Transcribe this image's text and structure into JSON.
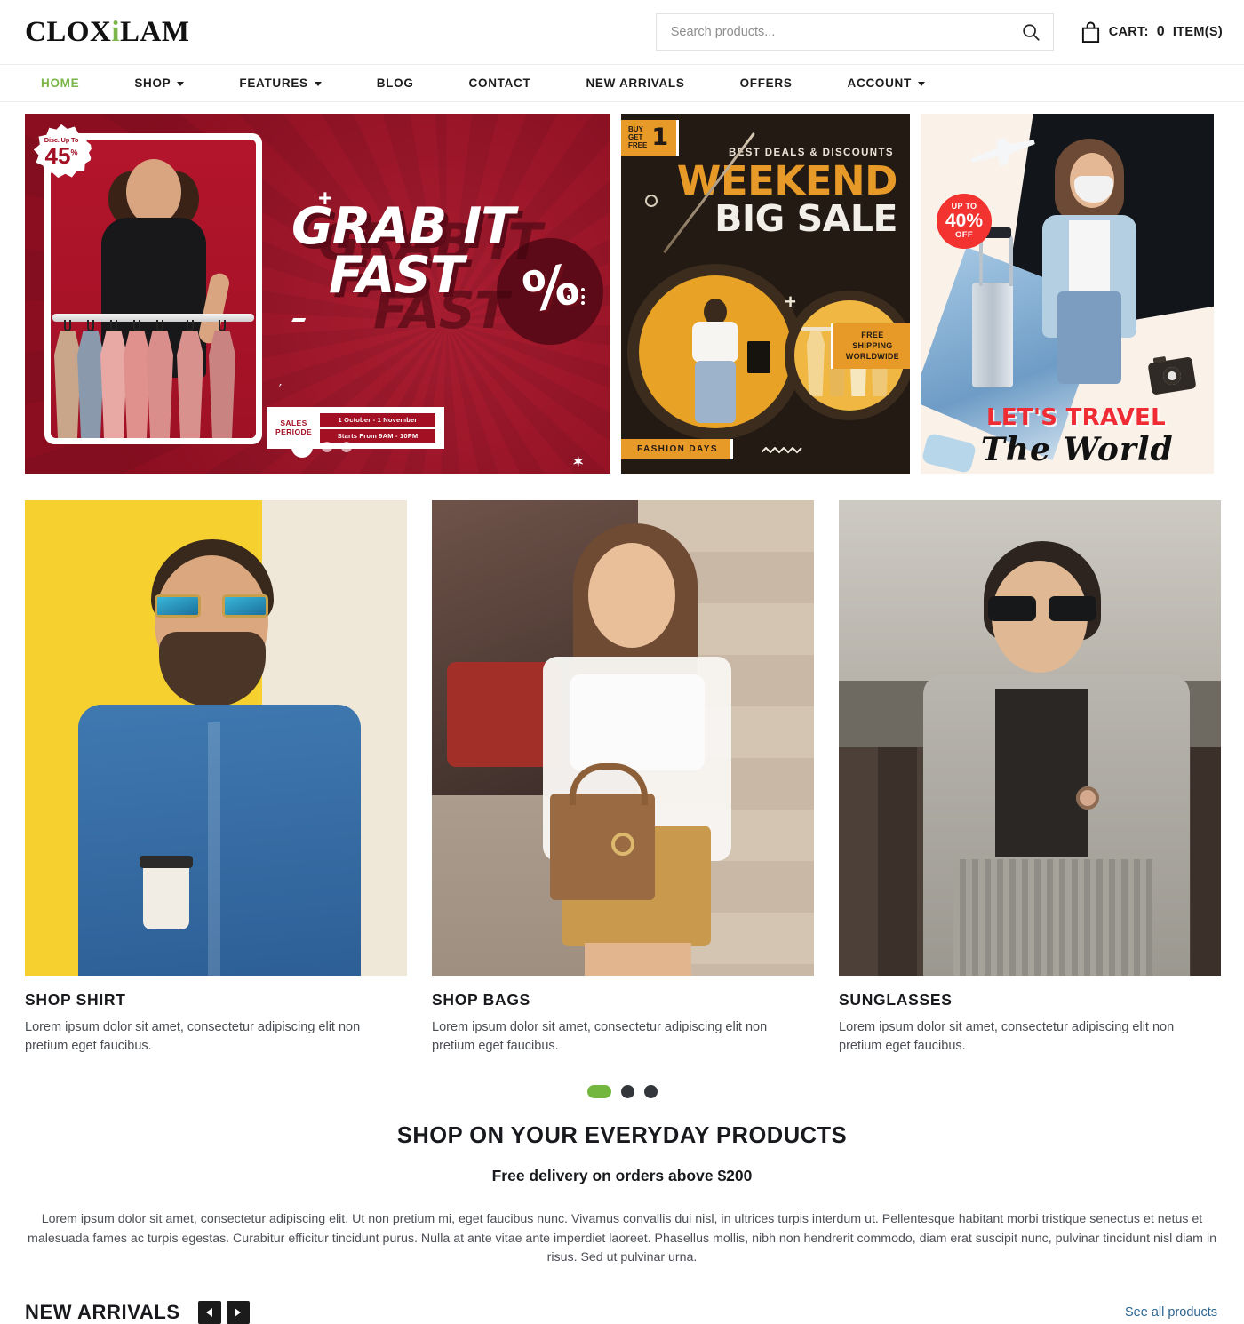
{
  "header": {
    "logo_part1": "CLOX",
    "logo_i": "i",
    "logo_part2": "LAM",
    "search_placeholder": "Search products...",
    "search_value": "",
    "cart_label": "CART:",
    "cart_count": "0",
    "cart_unit": "ITEM(S)"
  },
  "nav": {
    "items": [
      {
        "label": "HOME",
        "has_caret": false,
        "active": true
      },
      {
        "label": "SHOP",
        "has_caret": true,
        "active": false
      },
      {
        "label": "FEATURES",
        "has_caret": true,
        "active": false
      },
      {
        "label": "BLOG",
        "has_caret": false,
        "active": false
      },
      {
        "label": "CONTACT",
        "has_caret": false,
        "active": false
      },
      {
        "label": "NEW ARRIVALS",
        "has_caret": false,
        "active": false
      },
      {
        "label": "OFFERS",
        "has_caret": false,
        "active": false
      },
      {
        "label": "ACCOUNT",
        "has_caret": true,
        "active": false
      }
    ]
  },
  "banners": {
    "banner1": {
      "badge_label": "Disc. Up To",
      "badge_value": "45",
      "badge_pct": "%",
      "title_line1": "GRAB IT",
      "title_line2": "FAST",
      "ghost_line1": "GRAB IT",
      "ghost_line2": "FAST",
      "percent_symbol": "%",
      "sales_label_line1": "SALES",
      "sales_label_line2": "PERIODE",
      "sales_dates": "1 October - 1 November",
      "sales_hours": "Starts From 9AM - 10PM",
      "bg_color": "#a31024"
    },
    "banner2": {
      "buy_text": "BUY",
      "get_text": "GET",
      "free_text": "FREE",
      "one": "1",
      "kicker": "BEST DEALS & DISCOUNTS",
      "title1": "WEEKEND",
      "title2": "BIG SALE",
      "free_shipping_l1": "FREE",
      "free_shipping_l2": "SHIPPING",
      "free_shipping_l3": "WORLDWIDE",
      "plus": "+",
      "fashion_days": "FASHION DAYS",
      "bg_color": "#231a13",
      "accent_color": "#e89a28"
    },
    "banner3": {
      "badge_l1": "UP TO",
      "badge_l2": "40%",
      "badge_l3": "OFF",
      "title1": "LET'S TRAVEL",
      "title2": "The World",
      "bg_color": "#faf1e9",
      "badge_color": "#f2332f"
    },
    "hero_dots": [
      {
        "active": true
      },
      {
        "active": false
      },
      {
        "active": false
      }
    ]
  },
  "categories": [
    {
      "title": "SHOP SHIRT",
      "desc": "Lorem ipsum dolor sit amet, consectetur adipiscing elit non pretium eget faucibus."
    },
    {
      "title": "SHOP BAGS",
      "desc": "Lorem ipsum dolor sit amet, consectetur adipiscing elit non pretium eget faucibus."
    },
    {
      "title": "SUNGLASSES",
      "desc": "Lorem ipsum dolor sit amet, consectetur adipiscing elit non pretium eget faucibus."
    }
  ],
  "carousel_dots": [
    {
      "active": true
    },
    {
      "active": false
    },
    {
      "active": false
    }
  ],
  "promo": {
    "heading": "SHOP ON YOUR EVERYDAY PRODUCTS",
    "subheading": "Free delivery on orders above $200",
    "body": "Lorem ipsum dolor sit amet, consectetur adipiscing elit. Ut non pretium mi, eget faucibus nunc. Vivamus convallis dui nisl, in ultrices turpis interdum ut. Pellentesque habitant morbi tristique senectus et netus et malesuada fames ac turpis egestas. Curabitur efficitur tincidunt purus. Nulla at ante vitae ante imperdiet laoreet. Phasellus mollis, nibh non hendrerit commodo, diam erat suscipit nunc, pulvinar tincidunt nisl diam in risus. Sed ut pulvinar urna."
  },
  "arrivals": {
    "title": "NEW ARRIVALS",
    "prev_icon": "chevron-left-icon",
    "next_icon": "chevron-right-icon",
    "see_all": "See all products"
  },
  "colors": {
    "accent_green": "#7ab648",
    "link_blue": "#2b6591",
    "text_dark": "#17191c"
  }
}
